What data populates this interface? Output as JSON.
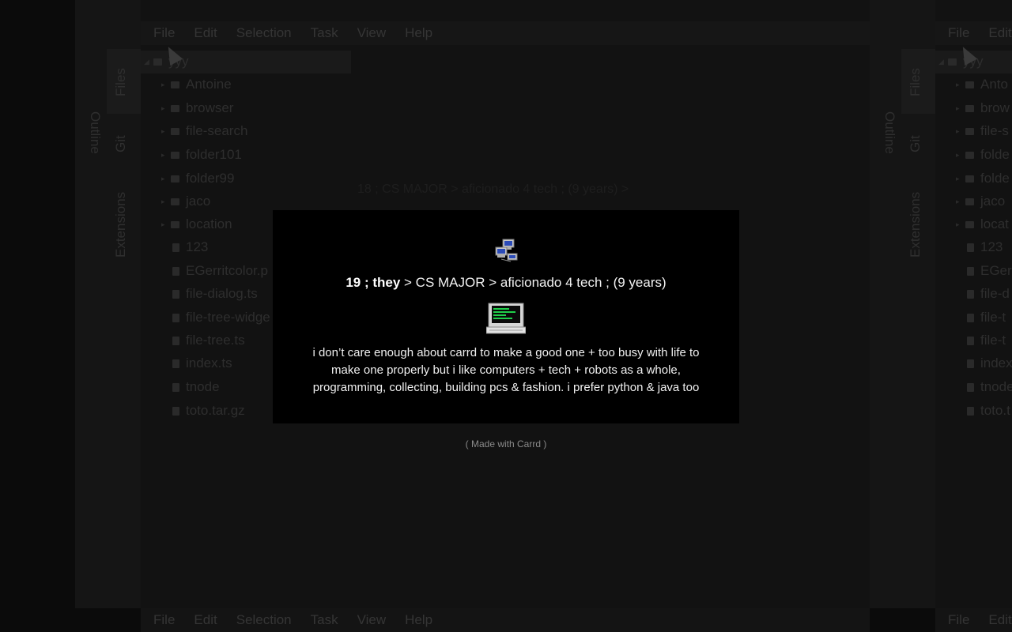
{
  "background_ide": {
    "menu": [
      "File",
      "Edit",
      "Selection",
      "Task",
      "View",
      "Help"
    ],
    "side_tabs": {
      "files": "Files",
      "outline": "Outline",
      "git": "Git",
      "extensions": "Extensions"
    },
    "tree": {
      "root": "yyy",
      "folders": [
        "Antoine",
        "browser",
        "file-search",
        "folder101",
        "folder99",
        "jaco",
        "location"
      ],
      "files": [
        "123",
        "EGerritcolor.p",
        "file-dialog.ts",
        "file-tree-widge",
        "file-tree.ts",
        "index.ts",
        "tnode",
        "toto.tar.gz"
      ]
    },
    "right_tree_files": [
      "Anto",
      "brow",
      "file-s",
      "folde",
      "folde",
      "jaco",
      "locat",
      "123",
      "EGer",
      "file-d",
      "file-t",
      "file-t",
      "index",
      "tnode",
      "toto.t"
    ],
    "right_menu": [
      "File",
      "Edit"
    ],
    "ghost_caption": "18 ; CS MAJOR > aficionado 4 tech ; (9 years) >"
  },
  "card": {
    "headline_bold": "19 ; they",
    "headline_rest": " > CS MAJOR > aficionado 4 tech ; (9 years)",
    "bio": "i don’t care enough about carrd to make a good one + too busy with life to make one properly but i like computers + tech + robots as a whole, programming, collecting, building pcs & fashion. i prefer python & java too",
    "icons": [
      "pc-network-icon",
      "computer-icon"
    ]
  },
  "footer": {
    "made_with": "( Made with Carrd )"
  },
  "colors": {
    "card_bg": "#000000",
    "page_bg": "#0b0b0b"
  }
}
